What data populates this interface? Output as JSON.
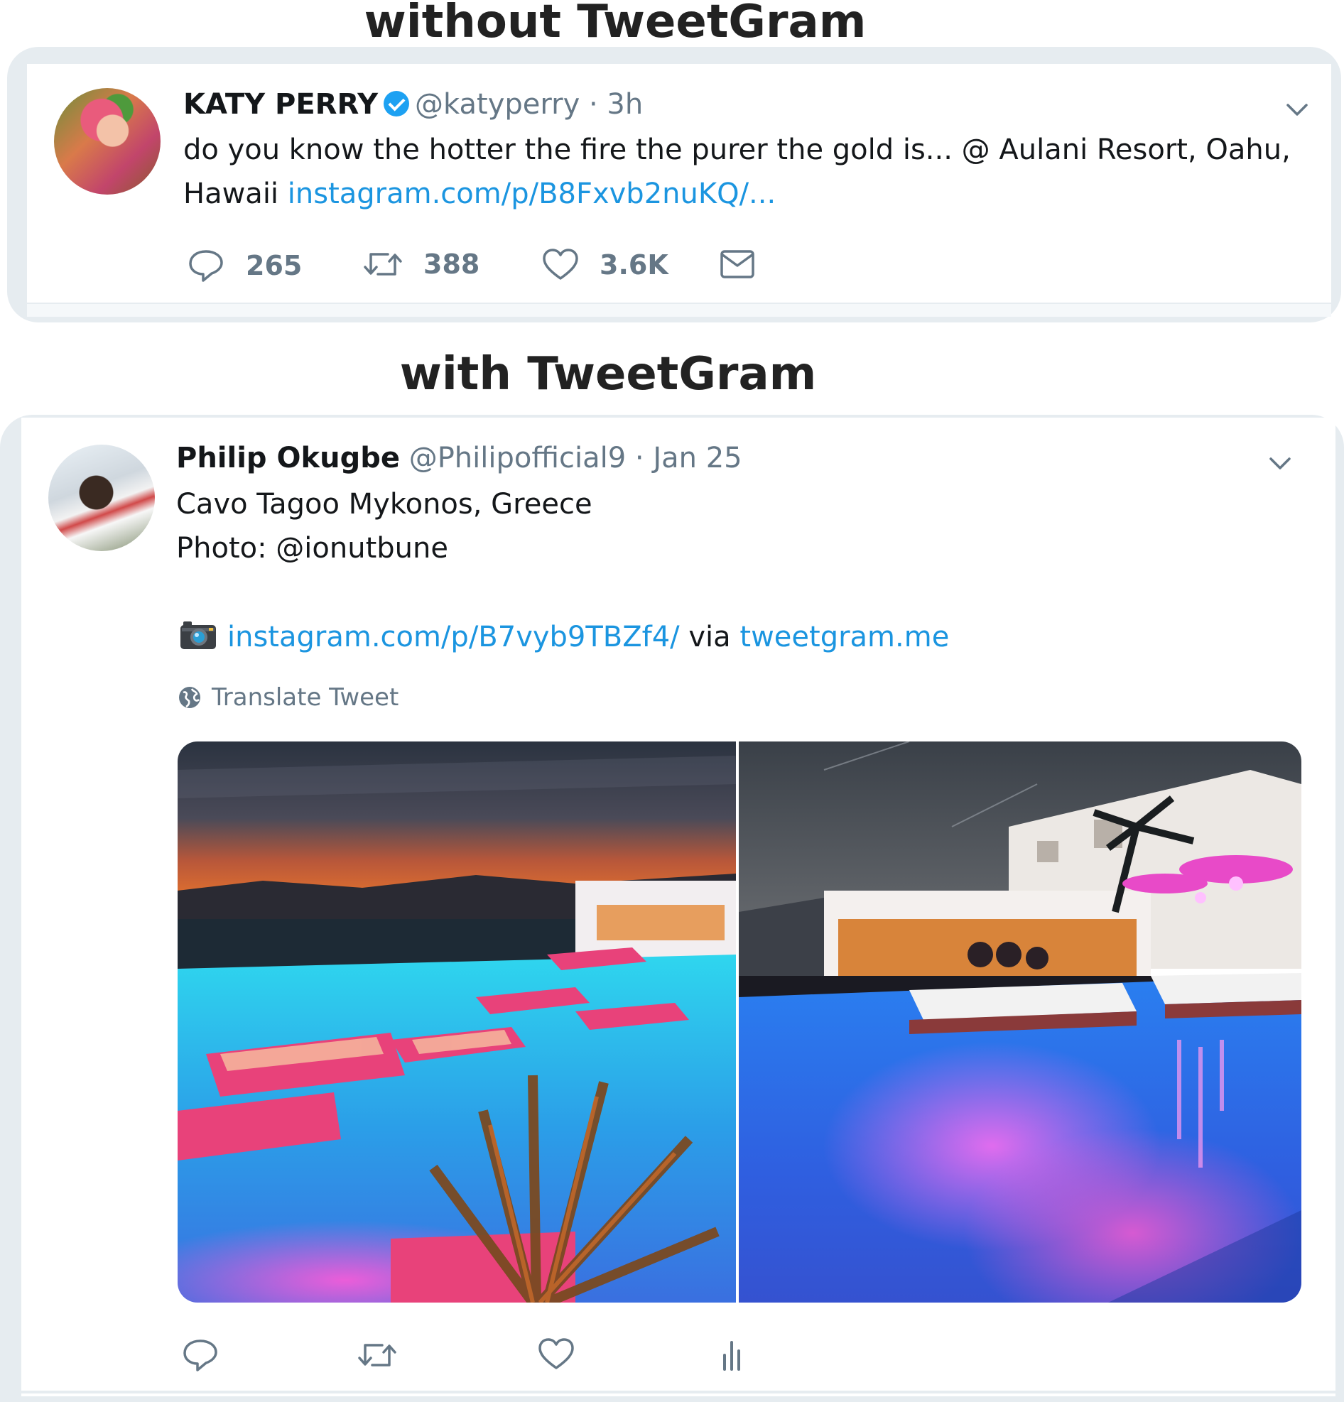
{
  "headings": {
    "without": "without TweetGram",
    "with": "with TweetGram"
  },
  "tweet1": {
    "name": "KATY PERRY",
    "verified": true,
    "handle_time": "@katyperry · 3h",
    "text_line1": "do you know the hotter the fire the purer the gold is... @ Aulani Resort, Oahu,",
    "text_line2_prefix": "Hawaii ",
    "link": "instagram.com/p/B8Fxvb2nuKQ/...",
    "replies": "265",
    "retweets": "388",
    "likes": "3.6K",
    "icons": [
      "reply-icon",
      "retweet-icon",
      "like-icon",
      "message-icon",
      "chevron-down-icon"
    ]
  },
  "tweet2": {
    "name": "Philip Okugbe",
    "handle_time": "@Philipofficial9 · Jan 25",
    "text_line1": "Cavo Tagoo Mykonos, Greece",
    "text_line2": "Photo: @ionutbune",
    "link": "instagram.com/p/B7vyb9TBZf4/",
    "via": " via ",
    "via_link": "tweetgram.me",
    "translate": "Translate Tweet",
    "icons": [
      "camera-icon",
      "globe-icon",
      "reply-icon",
      "retweet-icon",
      "like-icon",
      "analytics-icon",
      "chevron-down-icon"
    ]
  },
  "colors": {
    "link": "#1b95e0",
    "muted": "#657786",
    "text": "#14171a",
    "verified": "#1da1f2",
    "frame": "#e6ecf0"
  }
}
